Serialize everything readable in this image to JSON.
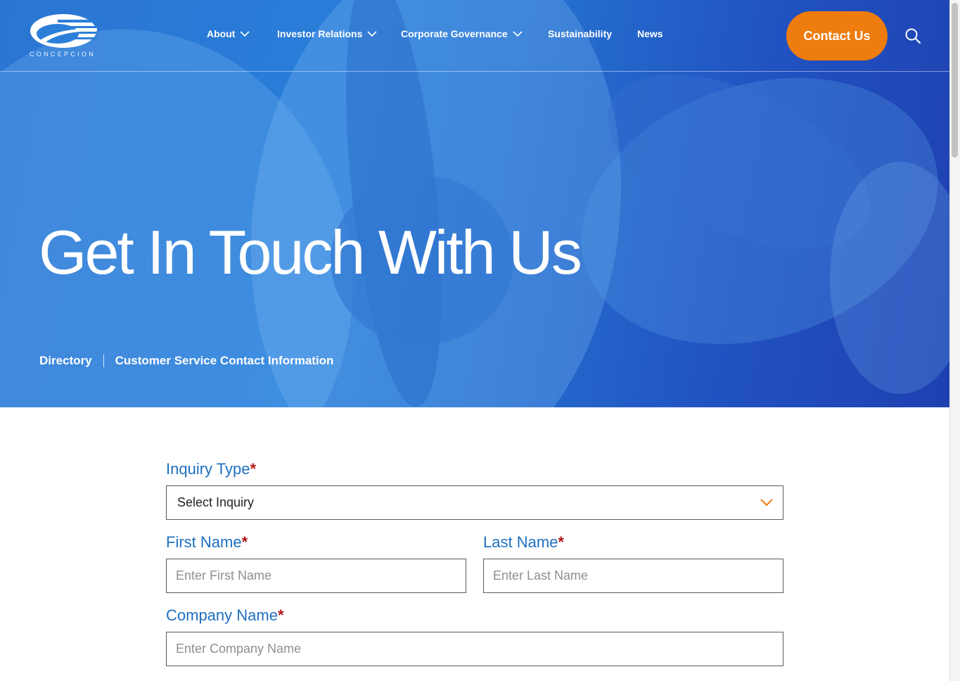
{
  "brand": {
    "name": "CONCEPCION"
  },
  "nav": {
    "items": [
      {
        "label": "About",
        "has_dropdown": true
      },
      {
        "label": "Investor Relations",
        "has_dropdown": true
      },
      {
        "label": "Corporate Governance",
        "has_dropdown": true
      },
      {
        "label": "Sustainability",
        "has_dropdown": false
      },
      {
        "label": "News",
        "has_dropdown": false
      }
    ],
    "cta_label": "Contact Us",
    "search_icon": "search-icon"
  },
  "hero": {
    "title": "Get In Touch With Us",
    "breadcrumb": [
      "Directory",
      "Customer Service Contact Information"
    ]
  },
  "form": {
    "inquiry_type": {
      "label": "Inquiry Type",
      "required_mark": "*",
      "value": "Select Inquiry"
    },
    "first_name": {
      "label": "First Name",
      "required_mark": "*",
      "placeholder": "Enter First Name"
    },
    "last_name": {
      "label": "Last Name",
      "required_mark": "*",
      "placeholder": "Enter Last Name"
    },
    "company_name": {
      "label": "Company Name",
      "required_mark": "*",
      "placeholder": "Enter Company Name"
    }
  },
  "colors": {
    "accent_orange": "#ee7c0e",
    "label_blue": "#1f6fc0",
    "required_red": "#b31818",
    "hero_blue": "#2677d2"
  }
}
